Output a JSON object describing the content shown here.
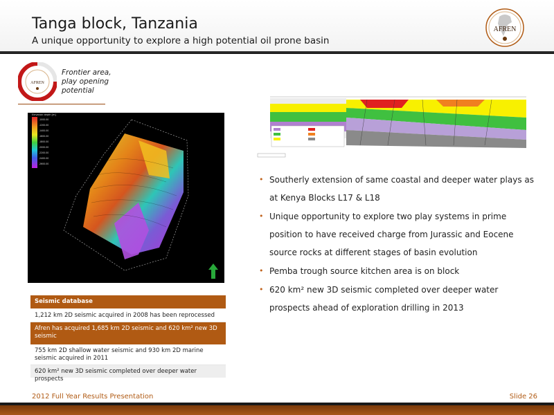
{
  "header": {
    "title": "Tanga block, Tanzania",
    "subtitle": "A unique opportunity to explore a high potential oil prone basin",
    "logo_text": "AFREN"
  },
  "badge": {
    "label": "Frontier area, play opening potential",
    "logo_text": "AFREN"
  },
  "seismic_map": {
    "legend_title": "Elevation depth [m]",
    "legend_values": [
      "-1000.00",
      "-1200.00",
      "-1400.00",
      "-1600.00",
      "-1800.00",
      "-2000.00",
      "-2200.00",
      "-2400.00",
      "-2600.00"
    ]
  },
  "bullets": [
    "Southerly extension of same coastal and deeper water plays as at Kenya Blocks L17 & L18",
    "Unique opportunity to explore two play systems in prime position to have received charge from Jurassic and Eocene source rocks at different stages of basin evolution",
    "Pemba trough source kitchen area is on block",
    "620 km² new 3D seismic completed over deeper water prospects ahead of exploration drilling in 2013"
  ],
  "table": {
    "header": "Seismic database",
    "rows": [
      "1,212 km 2D seismic acquired in 2008 has been reprocessed",
      "Afren has acquired 1,685 km 2D seismic and 620 km² new 3D seismic",
      "755 km 2D shallow water seismic and 930 km 2D marine seismic acquired in 2011",
      "620 km² new 3D seismic completed over deeper water prospects"
    ]
  },
  "footer": {
    "presentation": "2012 Full Year Results Presentation",
    "slide": "Slide 26"
  },
  "colors": {
    "accent": "#b05a13",
    "dark": "#1a1a1a"
  }
}
